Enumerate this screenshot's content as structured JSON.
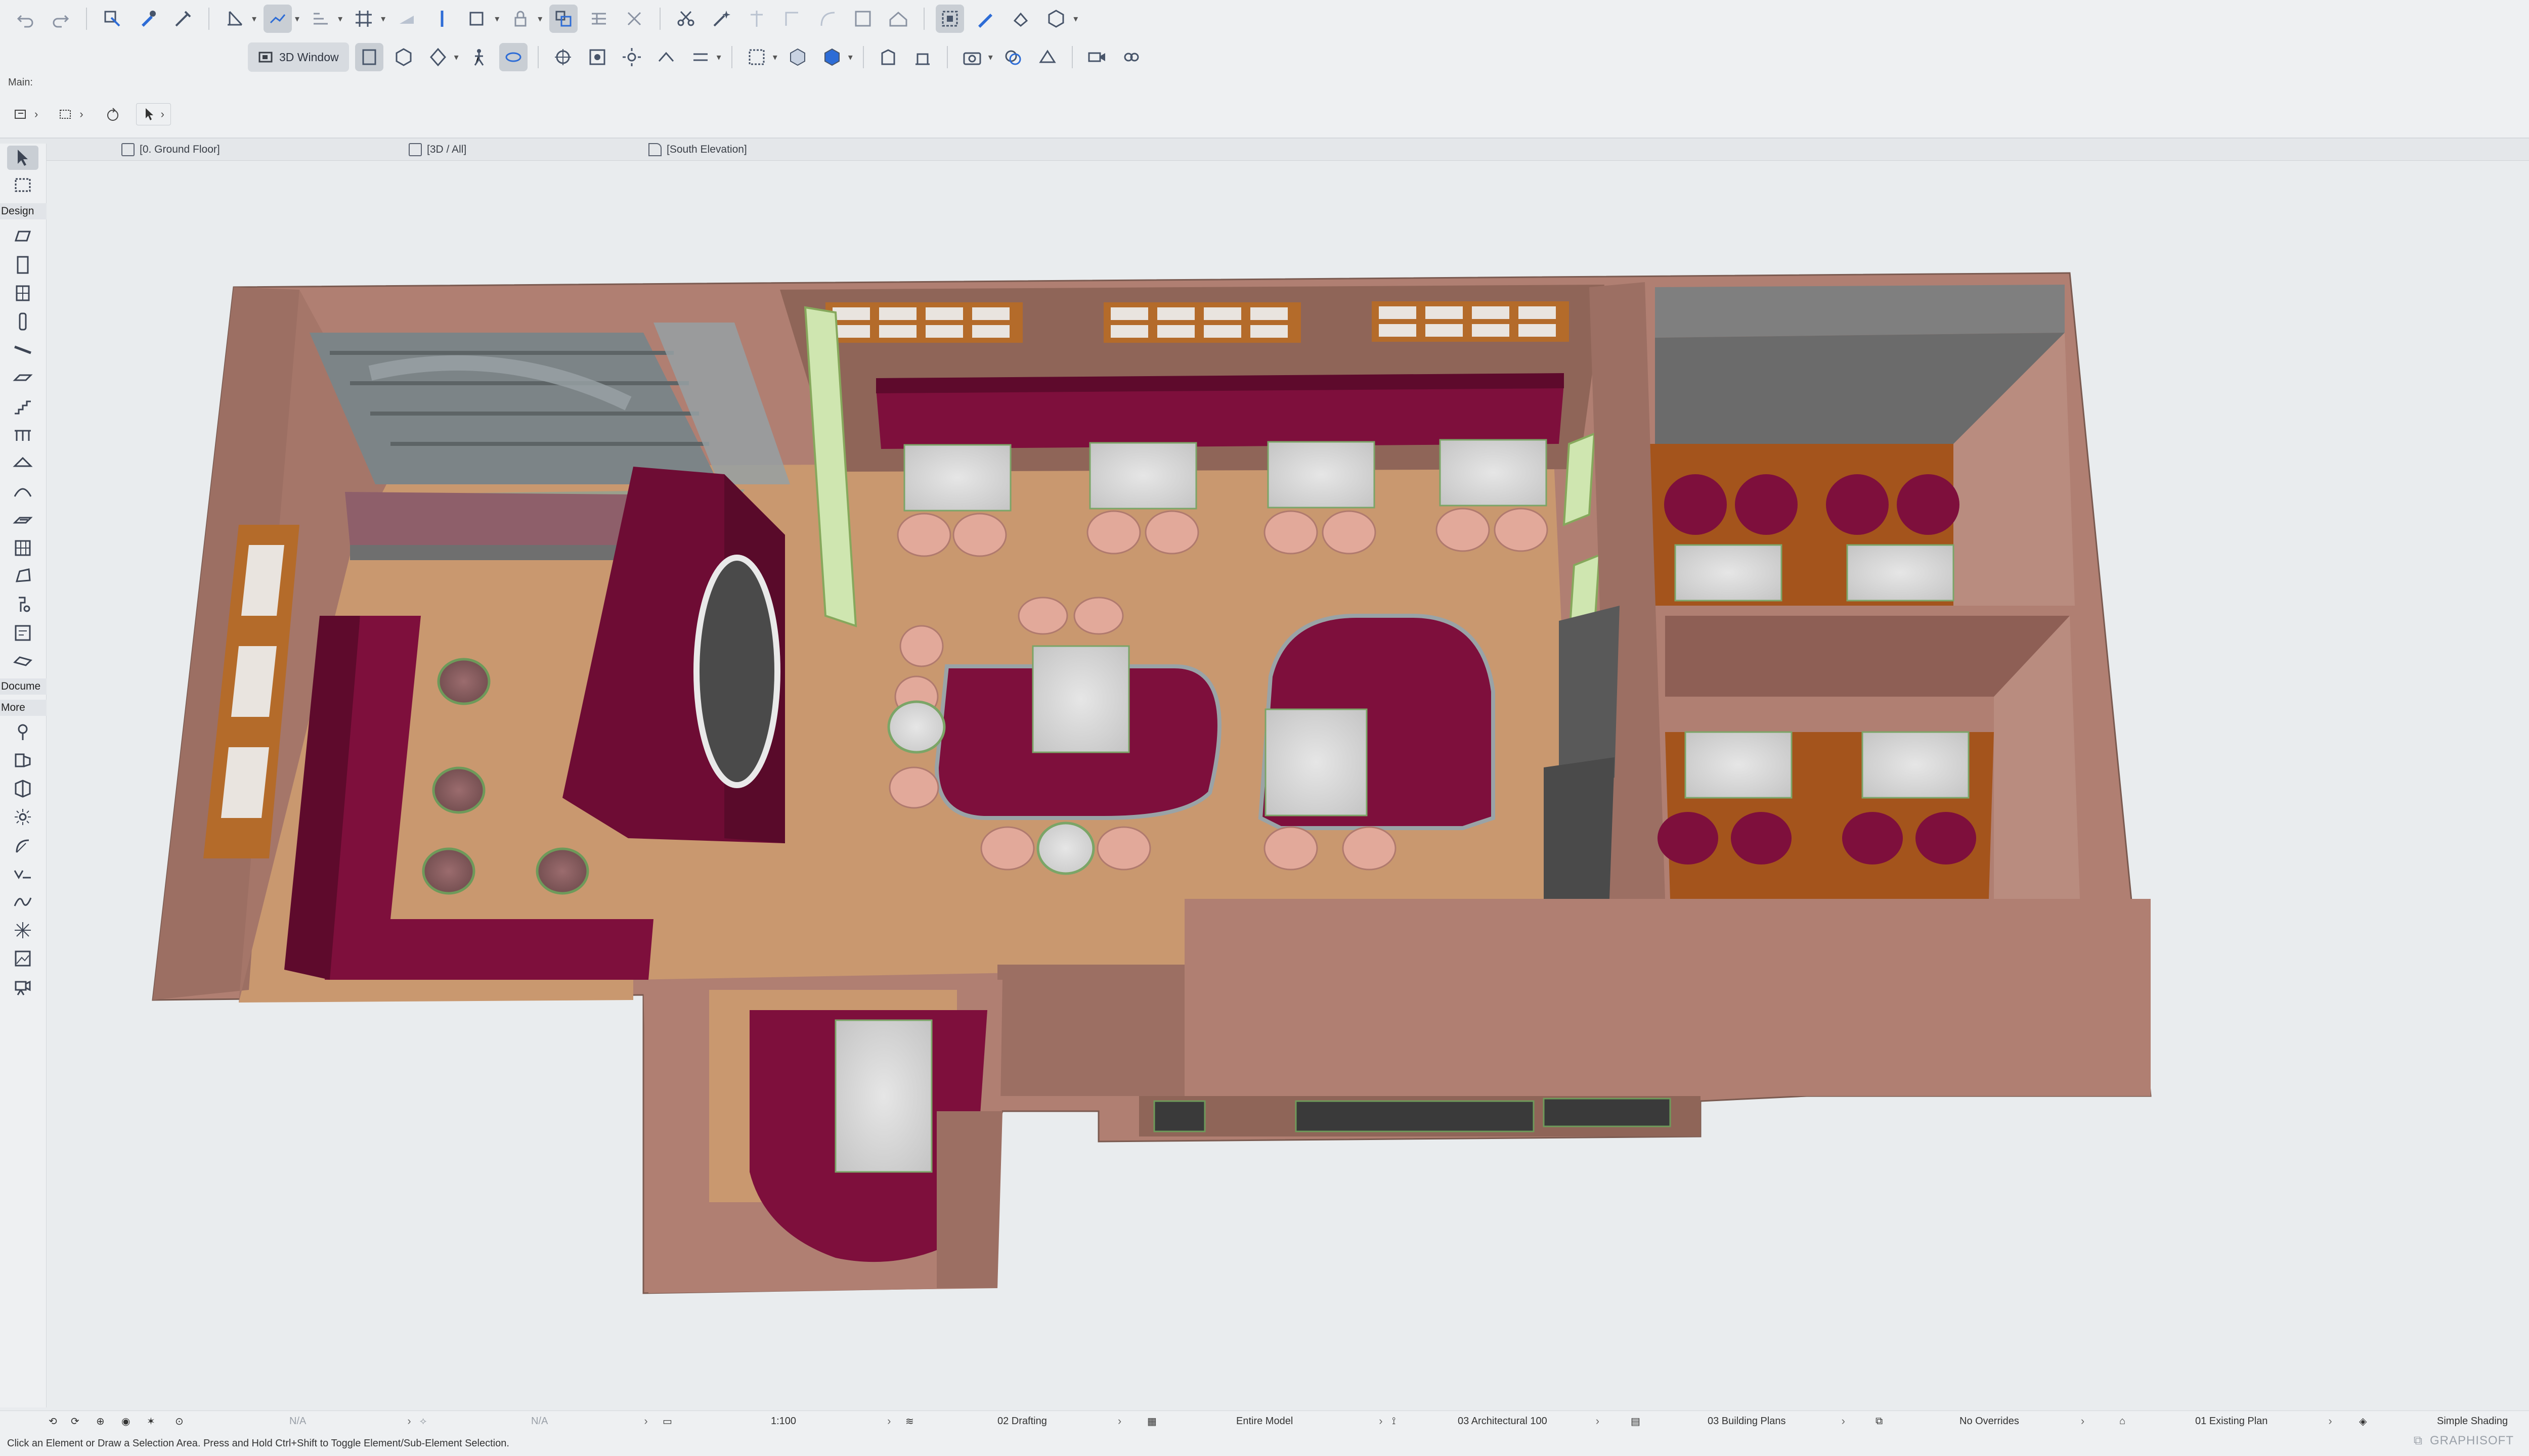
{
  "toolbar1": {
    "buttons": [
      "undo-icon",
      "redo-icon",
      "pick-up-icon",
      "eyedropper-icon",
      "inject-icon",
      "dimension-icon",
      "trace-icon",
      "grid-snap-icon",
      "fill-icon",
      "layer-icon",
      "lock-icon",
      "window-toggle-icon",
      "scissors-icon",
      "magic-wand-icon",
      "split-icon",
      "adjust-icon",
      "offset-icon",
      "resize-icon",
      "roof-icon",
      "select-3d-icon",
      "3d-edit-icon",
      "shape-icon",
      "cube-icon"
    ]
  },
  "toolbar2": {
    "window_label": "3D Window"
  },
  "infobar": {
    "main_label": "Main:"
  },
  "tabs": {
    "tab1": "[0. Ground Floor]",
    "tab2": "[3D / All]",
    "tab3": "[South Elevation]"
  },
  "toolbox": {
    "section_design": "Design",
    "section_document": "Docume",
    "section_more": "More"
  },
  "statusbar": {
    "na1": "N/A",
    "na2": "N/A",
    "scale": "1:100",
    "layer_combo": "02 Drafting",
    "model_view": "Entire Model",
    "pen_set": "03 Architectural 100",
    "mvo": "03 Building Plans",
    "override": "No Overrides",
    "renovation": "01 Existing Plan",
    "shading": "Simple Shading"
  },
  "hint": "Click an Element or Draw a Selection Area. Press and Hold Ctrl+Shift to Toggle Element/Sub-Element Selection.",
  "brand": "GRAPHISOFT",
  "colors": {
    "wall": "#b07f72",
    "floor": "#c9986f",
    "upholstery": "#7e0f3c",
    "wood_floor": "#a4541c",
    "chair": "#e2a99a",
    "marble": "#dcdcdc"
  }
}
